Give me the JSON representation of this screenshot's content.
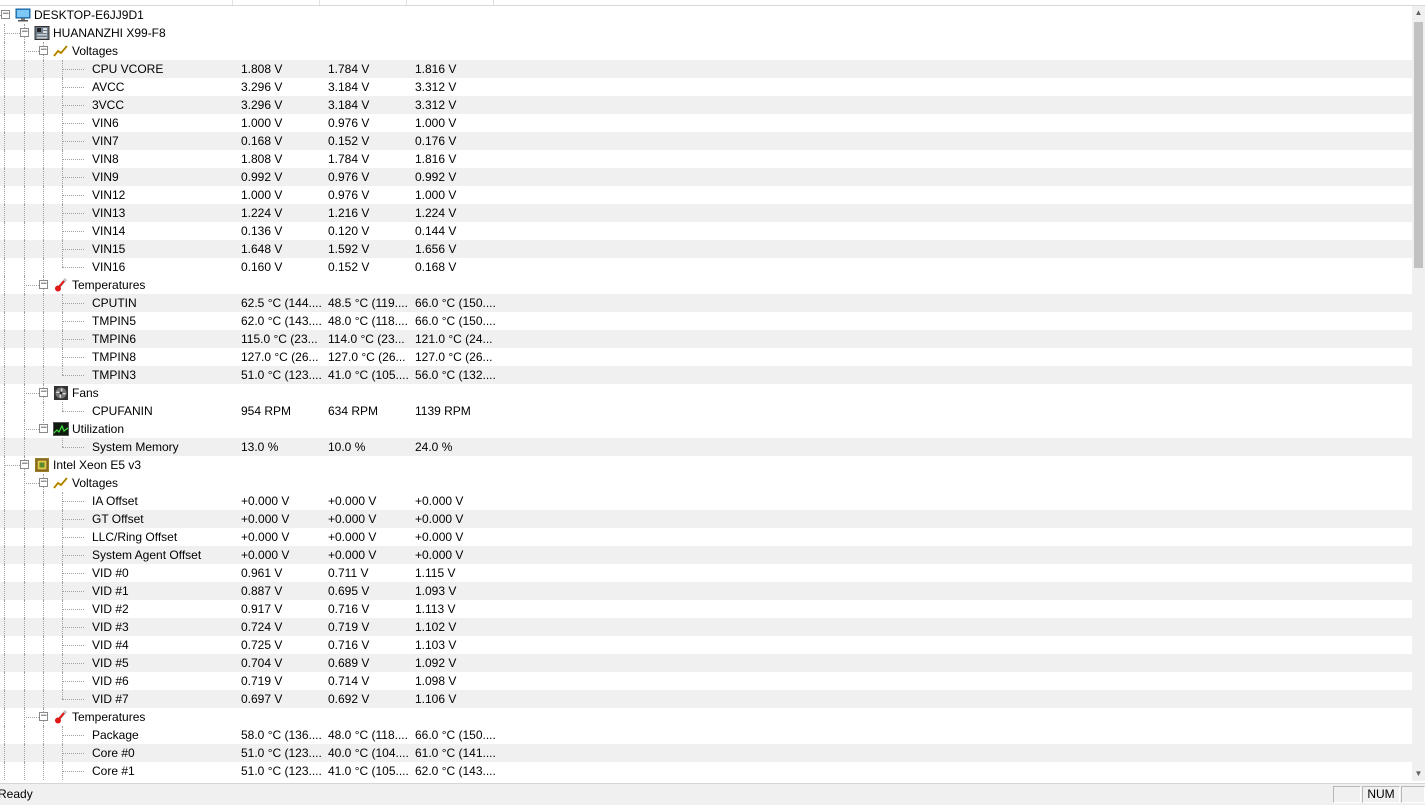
{
  "statusbar": {
    "status": "Ready",
    "num": "NUM"
  },
  "tree": [
    {
      "type": "node",
      "depth": 0,
      "label": "DESKTOP-E6JJ9D1",
      "icon": "computer-icon"
    },
    {
      "type": "node",
      "depth": 1,
      "label": "HUANANZHI X99-F8",
      "icon": "motherboard-icon"
    },
    {
      "type": "node",
      "depth": 2,
      "label": "Voltages",
      "icon": "voltage-icon"
    },
    {
      "type": "sensor",
      "label": "CPU VCORE",
      "value": "1.808 V",
      "min": "1.784 V",
      "max": "1.816 V"
    },
    {
      "type": "sensor",
      "label": "AVCC",
      "value": "3.296 V",
      "min": "3.184 V",
      "max": "3.312 V"
    },
    {
      "type": "sensor",
      "label": "3VCC",
      "value": "3.296 V",
      "min": "3.184 V",
      "max": "3.312 V"
    },
    {
      "type": "sensor",
      "label": "VIN6",
      "value": "1.000 V",
      "min": "0.976 V",
      "max": "1.000 V"
    },
    {
      "type": "sensor",
      "label": "VIN7",
      "value": "0.168 V",
      "min": "0.152 V",
      "max": "0.176 V"
    },
    {
      "type": "sensor",
      "label": "VIN8",
      "value": "1.808 V",
      "min": "1.784 V",
      "max": "1.816 V"
    },
    {
      "type": "sensor",
      "label": "VIN9",
      "value": "0.992 V",
      "min": "0.976 V",
      "max": "0.992 V"
    },
    {
      "type": "sensor",
      "label": "VIN12",
      "value": "1.000 V",
      "min": "0.976 V",
      "max": "1.000 V"
    },
    {
      "type": "sensor",
      "label": "VIN13",
      "value": "1.224 V",
      "min": "1.216 V",
      "max": "1.224 V"
    },
    {
      "type": "sensor",
      "label": "VIN14",
      "value": "0.136 V",
      "min": "0.120 V",
      "max": "0.144 V"
    },
    {
      "type": "sensor",
      "label": "VIN15",
      "value": "1.648 V",
      "min": "1.592 V",
      "max": "1.656 V"
    },
    {
      "type": "sensor",
      "label": "VIN16",
      "value": "0.160 V",
      "min": "0.152 V",
      "max": "0.168 V",
      "last": true
    },
    {
      "type": "node",
      "depth": 2,
      "label": "Temperatures",
      "icon": "thermometer-icon"
    },
    {
      "type": "sensor",
      "label": "CPUTIN",
      "value": "62.5 °C  (144....",
      "min": "48.5 °C  (119....",
      "max": "66.0 °C  (150...."
    },
    {
      "type": "sensor",
      "label": "TMPIN5",
      "value": "62.0 °C  (143....",
      "min": "48.0 °C  (118....",
      "max": "66.0 °C  (150...."
    },
    {
      "type": "sensor",
      "label": "TMPIN6",
      "value": "115.0 °C  (23...",
      "min": "114.0 °C  (23...",
      "max": "121.0 °C  (24..."
    },
    {
      "type": "sensor",
      "label": "TMPIN8",
      "value": "127.0 °C  (26...",
      "min": "127.0 °C  (26...",
      "max": "127.0 °C  (26..."
    },
    {
      "type": "sensor",
      "label": "TMPIN3",
      "value": "51.0 °C  (123....",
      "min": "41.0 °C  (105....",
      "max": "56.0 °C  (132....",
      "last": true
    },
    {
      "type": "node",
      "depth": 2,
      "label": "Fans",
      "icon": "fan-icon"
    },
    {
      "type": "sensor",
      "label": "CPUFANIN",
      "value": "954 RPM",
      "min": "634 RPM",
      "max": "1139 RPM",
      "last": true
    },
    {
      "type": "node",
      "depth": 2,
      "label": "Utilization",
      "icon": "utilization-icon",
      "lastNode": true
    },
    {
      "type": "sensor",
      "label": "System Memory",
      "value": "13.0 %",
      "min": "10.0 %",
      "max": "24.0 %",
      "last": true
    },
    {
      "type": "node",
      "depth": 1,
      "label": "Intel Xeon E5 v3",
      "icon": "cpu-icon"
    },
    {
      "type": "node",
      "depth": 2,
      "label": "Voltages",
      "icon": "voltage-icon"
    },
    {
      "type": "sensor",
      "label": "IA Offset",
      "value": "+0.000 V",
      "min": "+0.000 V",
      "max": "+0.000 V"
    },
    {
      "type": "sensor",
      "label": "GT Offset",
      "value": "+0.000 V",
      "min": "+0.000 V",
      "max": "+0.000 V"
    },
    {
      "type": "sensor",
      "label": "LLC/Ring Offset",
      "value": "+0.000 V",
      "min": "+0.000 V",
      "max": "+0.000 V"
    },
    {
      "type": "sensor",
      "label": "System Agent Offset",
      "value": "+0.000 V",
      "min": "+0.000 V",
      "max": "+0.000 V"
    },
    {
      "type": "sensor",
      "label": "VID #0",
      "value": "0.961 V",
      "min": "0.711 V",
      "max": "1.115 V"
    },
    {
      "type": "sensor",
      "label": "VID #1",
      "value": "0.887 V",
      "min": "0.695 V",
      "max": "1.093 V"
    },
    {
      "type": "sensor",
      "label": "VID #2",
      "value": "0.917 V",
      "min": "0.716 V",
      "max": "1.113 V"
    },
    {
      "type": "sensor",
      "label": "VID #3",
      "value": "0.724 V",
      "min": "0.719 V",
      "max": "1.102 V"
    },
    {
      "type": "sensor",
      "label": "VID #4",
      "value": "0.725 V",
      "min": "0.716 V",
      "max": "1.103 V"
    },
    {
      "type": "sensor",
      "label": "VID #5",
      "value": "0.704 V",
      "min": "0.689 V",
      "max": "1.092 V"
    },
    {
      "type": "sensor",
      "label": "VID #6",
      "value": "0.719 V",
      "min": "0.714 V",
      "max": "1.098 V"
    },
    {
      "type": "sensor",
      "label": "VID #7",
      "value": "0.697 V",
      "min": "0.692 V",
      "max": "1.106 V",
      "last": true
    },
    {
      "type": "node",
      "depth": 2,
      "label": "Temperatures",
      "icon": "thermometer-icon"
    },
    {
      "type": "sensor",
      "label": "Package",
      "value": "58.0 °C  (136....",
      "min": "48.0 °C  (118....",
      "max": "66.0 °C  (150...."
    },
    {
      "type": "sensor",
      "label": "Core #0",
      "value": "51.0 °C  (123....",
      "min": "40.0 °C  (104....",
      "max": "61.0 °C  (141...."
    },
    {
      "type": "sensor",
      "label": "Core #1",
      "value": "51.0 °C  (123....",
      "min": "41.0 °C  (105....",
      "max": "62.0 °C  (143...."
    }
  ]
}
